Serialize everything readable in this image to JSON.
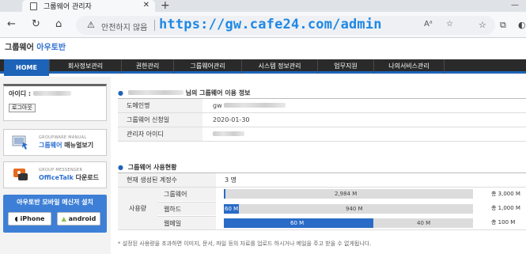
{
  "browser": {
    "tab_title": "그룹웨어 관리자",
    "not_secure_label": "안전하지 않음",
    "url": "https://gw.cafe24.com/admin"
  },
  "header": {
    "brand_main": "그룹웨어",
    "brand_accent": "아우토반"
  },
  "menu": {
    "home": "HOME",
    "items": [
      "회사정보관리",
      "권한관리",
      "그룹웨어관리",
      "시스템 정보관리",
      "업무지원",
      "나의서비스관리"
    ]
  },
  "sidebar": {
    "id_label": "아이디 :",
    "logout_label": "로그아웃",
    "manual": {
      "sub": "GROUPWARE MANUAL",
      "main_accent": "그룹웨어",
      "main_rest": "매뉴얼보기"
    },
    "messenger": {
      "sub": "GROUP MESSENGER",
      "main": "OfficeTalk",
      "main_rest": "다운로드"
    },
    "mobile": {
      "title": "아우토반 모바일 메신저 설치",
      "iphone": "iPhone",
      "android": "android"
    }
  },
  "info": {
    "title_suffix": "님의 그룹웨어 이용 정보",
    "rows": [
      {
        "label": "도메인명",
        "value": "gw"
      },
      {
        "label": "그룹웨어 신청일",
        "value": "2020-01-30"
      },
      {
        "label": "관리자 아이디",
        "value": ""
      }
    ]
  },
  "usage": {
    "title": "그룹웨어 사용현황",
    "accounts_label": "현재 생성된 계정수",
    "accounts_value": "3 명",
    "usage_label": "사용량",
    "services": [
      {
        "name": "그룹웨어",
        "used": "2,984 M",
        "quota": "총 3,000 M",
        "fill": 0.005,
        "used_inside": false
      },
      {
        "name": "웹하드",
        "used": "60 M",
        "remaining": "940 M",
        "quota": "총 1,000 M",
        "fill": 0.06
      },
      {
        "name": "웹메일",
        "used": "60 M",
        "remaining": "40 M",
        "quota": "총 100 M",
        "fill": 0.6
      }
    ]
  },
  "notice": "* 설정된 사용량을 초과하면 이미지, 문서, 파일 등의 자료를 업로드 하시거나 메일을 주고 받을 수 없게됩니다."
}
